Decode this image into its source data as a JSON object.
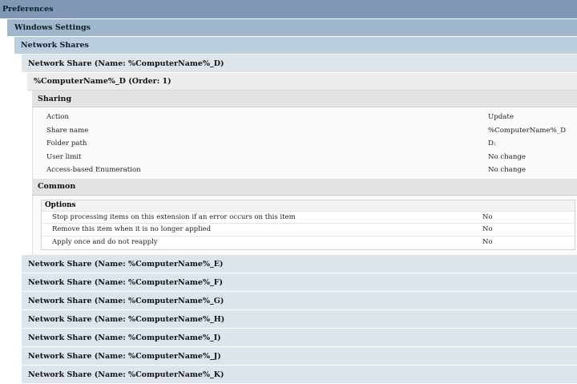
{
  "preferences_label": "Preferences",
  "windows_settings_label": "Windows Settings",
  "network_shares_label": "Network Shares",
  "expanded_share": {
    "title": "Network Share (Name: %ComputerName%_D)",
    "item_title": "%ComputerName%_D (Order: 1)",
    "sharing_label": "Sharing",
    "properties": [
      {
        "key": "Action",
        "value": "Update"
      },
      {
        "key": "Share name",
        "value": "%ComputerName%_D"
      },
      {
        "key": "Folder path",
        "value": "D:"
      },
      {
        "key": "User limit",
        "value": "No change"
      },
      {
        "key": "Access-based Enumeration",
        "value": "No change"
      }
    ],
    "common_label": "Common",
    "options_label": "Options",
    "options": [
      {
        "key": "Stop processing items on this extension if an error occurs on this item",
        "value": "No"
      },
      {
        "key": "Remove this item when it is no longer applied",
        "value": "No"
      },
      {
        "key": "Apply once and do not reapply",
        "value": "No"
      }
    ]
  },
  "collapsed_shares": [
    "Network Share (Name: %ComputerName%_E)",
    "Network Share (Name: %ComputerName%_F)",
    "Network Share (Name: %ComputerName%_G)",
    "Network Share (Name: %ComputerName%_H)",
    "Network Share (Name: %ComputerName%_I)",
    "Network Share (Name: %ComputerName%_J)",
    "Network Share (Name: %ComputerName%_K)"
  ]
}
